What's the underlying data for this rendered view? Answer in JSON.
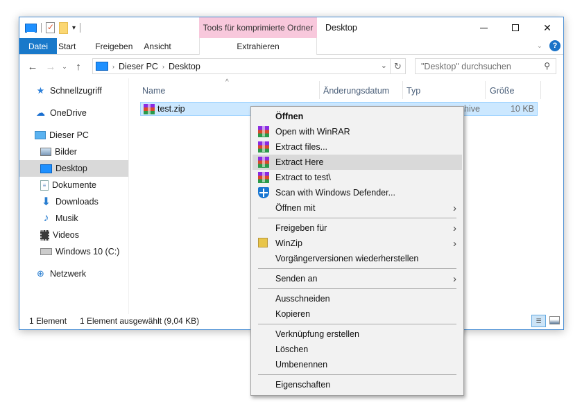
{
  "window": {
    "title": "Desktop",
    "contextual_tab_group": "Tools für komprimierte Ordner",
    "controls": {
      "minimize": "minimize",
      "maximize": "maximize",
      "close": "✕"
    }
  },
  "quick_access_toolbar": {
    "icons": [
      "monitor-icon",
      "properties-icon",
      "new-folder-icon",
      "customize-dropdown-icon"
    ],
    "dropdown_glyph": "▾"
  },
  "ribbon": {
    "tabs": [
      {
        "label": "Datei",
        "active": true
      },
      {
        "label": "Start"
      },
      {
        "label": "Freigeben"
      },
      {
        "label": "Ansicht"
      },
      {
        "label": "Extrahieren"
      }
    ],
    "collapse_glyph": "⌄",
    "help_glyph": "?"
  },
  "navigation": {
    "back": "←",
    "forward": "→",
    "recent": "⌄",
    "up": "↑",
    "breadcrumb": [
      "Dieser PC",
      "Desktop"
    ],
    "crumb_separator": "›",
    "address_dropdown": "⌄",
    "refresh": "↻"
  },
  "search": {
    "placeholder": "\"Desktop\" durchsuchen",
    "icon": "⚲"
  },
  "sidebar": {
    "items": [
      {
        "label": "Schnellzugriff",
        "icon": "★"
      },
      {
        "label": "OneDrive",
        "icon": "☁"
      },
      {
        "label": "Dieser PC",
        "icon": ""
      },
      {
        "label": "Bilder",
        "icon": ""
      },
      {
        "label": "Desktop",
        "icon": "",
        "selected": true
      },
      {
        "label": "Dokumente",
        "icon": "≡"
      },
      {
        "label": "Downloads",
        "icon": "⬇"
      },
      {
        "label": "Musik",
        "icon": "♪"
      },
      {
        "label": "Videos",
        "icon": ""
      },
      {
        "label": "Windows 10 (C:)",
        "icon": ""
      },
      {
        "label": "Netzwerk",
        "icon": "⊕"
      }
    ]
  },
  "filelist": {
    "sort_indicator": "^",
    "columns": [
      "Name",
      "Änderungsdatum",
      "Typ",
      "Größe"
    ],
    "rows": [
      {
        "name": "test.zip",
        "type_visible": "hive",
        "size": "10 KB",
        "selected": true
      }
    ]
  },
  "statusbar": {
    "count": "1 Element",
    "selection": "1 Element ausgewählt (9,04 KB)",
    "details_view_glyph": "☰"
  },
  "context_menu": {
    "items": [
      {
        "label": "Öffnen",
        "bold": true
      },
      {
        "label": "Open with WinRAR",
        "icon": "winrar-icon"
      },
      {
        "label": "Extract files...",
        "icon": "winrar-icon"
      },
      {
        "label": "Extract Here",
        "icon": "winrar-icon",
        "hover": true
      },
      {
        "label": "Extract to test\\",
        "icon": "winrar-icon"
      },
      {
        "label": "Scan with Windows Defender...",
        "icon": "defender-shield-icon"
      },
      {
        "label": "Öffnen mit",
        "submenu": true
      },
      {
        "label": "Freigeben für",
        "submenu": true
      },
      {
        "label": "WinZip",
        "icon": "winzip-icon",
        "submenu": true
      },
      {
        "label": "Vorgängerversionen wiederherstellen"
      },
      {
        "label": "Senden an",
        "submenu": true
      },
      {
        "label": "Ausschneiden"
      },
      {
        "label": "Kopieren"
      },
      {
        "label": "Verknüpfung erstellen"
      },
      {
        "label": "Löschen"
      },
      {
        "label": "Umbenennen"
      },
      {
        "label": "Eigenschaften"
      }
    ],
    "submenu_glyph": "›"
  }
}
